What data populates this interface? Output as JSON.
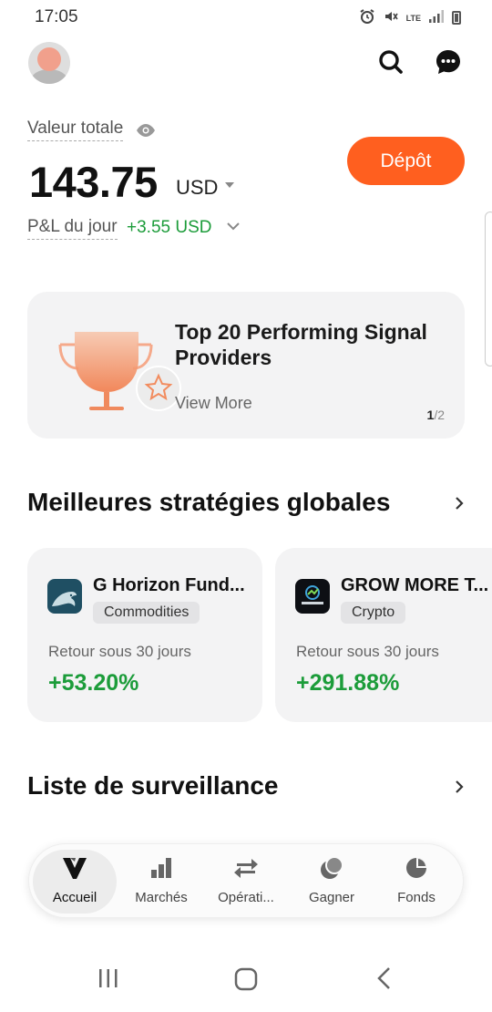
{
  "status_bar": {
    "time": "17:05",
    "network": "LTE"
  },
  "header": {
    "avatar_icon": "user-avatar",
    "search_icon": "search-icon",
    "messages_icon": "chat-bubble-icon"
  },
  "balance": {
    "label": "Valeur totale",
    "amount": "143.75",
    "currency": "USD",
    "pl_label": "P&L du jour",
    "pl_value": "+3.55 USD",
    "deposit_label": "Dépôt"
  },
  "banner": {
    "title": "Top 20 Performing Signal Providers",
    "link": "View More",
    "page_current": "1",
    "page_total": "/2"
  },
  "strategies": {
    "title": "Meilleures stratégies globales",
    "cards": [
      {
        "name": "G Horizon Fund...",
        "tag": "Commodities",
        "return_label": "Retour sous 30 jours",
        "return_value": "+53.20%"
      },
      {
        "name": "GROW MORE T...",
        "tag": "Crypto",
        "return_label": "Retour sous 30 jours",
        "return_value": "+291.88%"
      }
    ]
  },
  "watchlist": {
    "title": "Liste de surveillance"
  },
  "bottom_nav": {
    "items": [
      {
        "label": "Accueil",
        "icon": "home-logo-icon",
        "active": true
      },
      {
        "label": "Marchés",
        "icon": "bar-chart-icon"
      },
      {
        "label": "Opérati...",
        "icon": "swap-arrows-icon"
      },
      {
        "label": "Gagner",
        "icon": "coins-icon"
      },
      {
        "label": "Fonds",
        "icon": "pie-chart-icon"
      }
    ]
  },
  "colors": {
    "accent": "#ff5f1f",
    "positive": "#1c9c3a",
    "card_bg": "#f3f3f4"
  }
}
